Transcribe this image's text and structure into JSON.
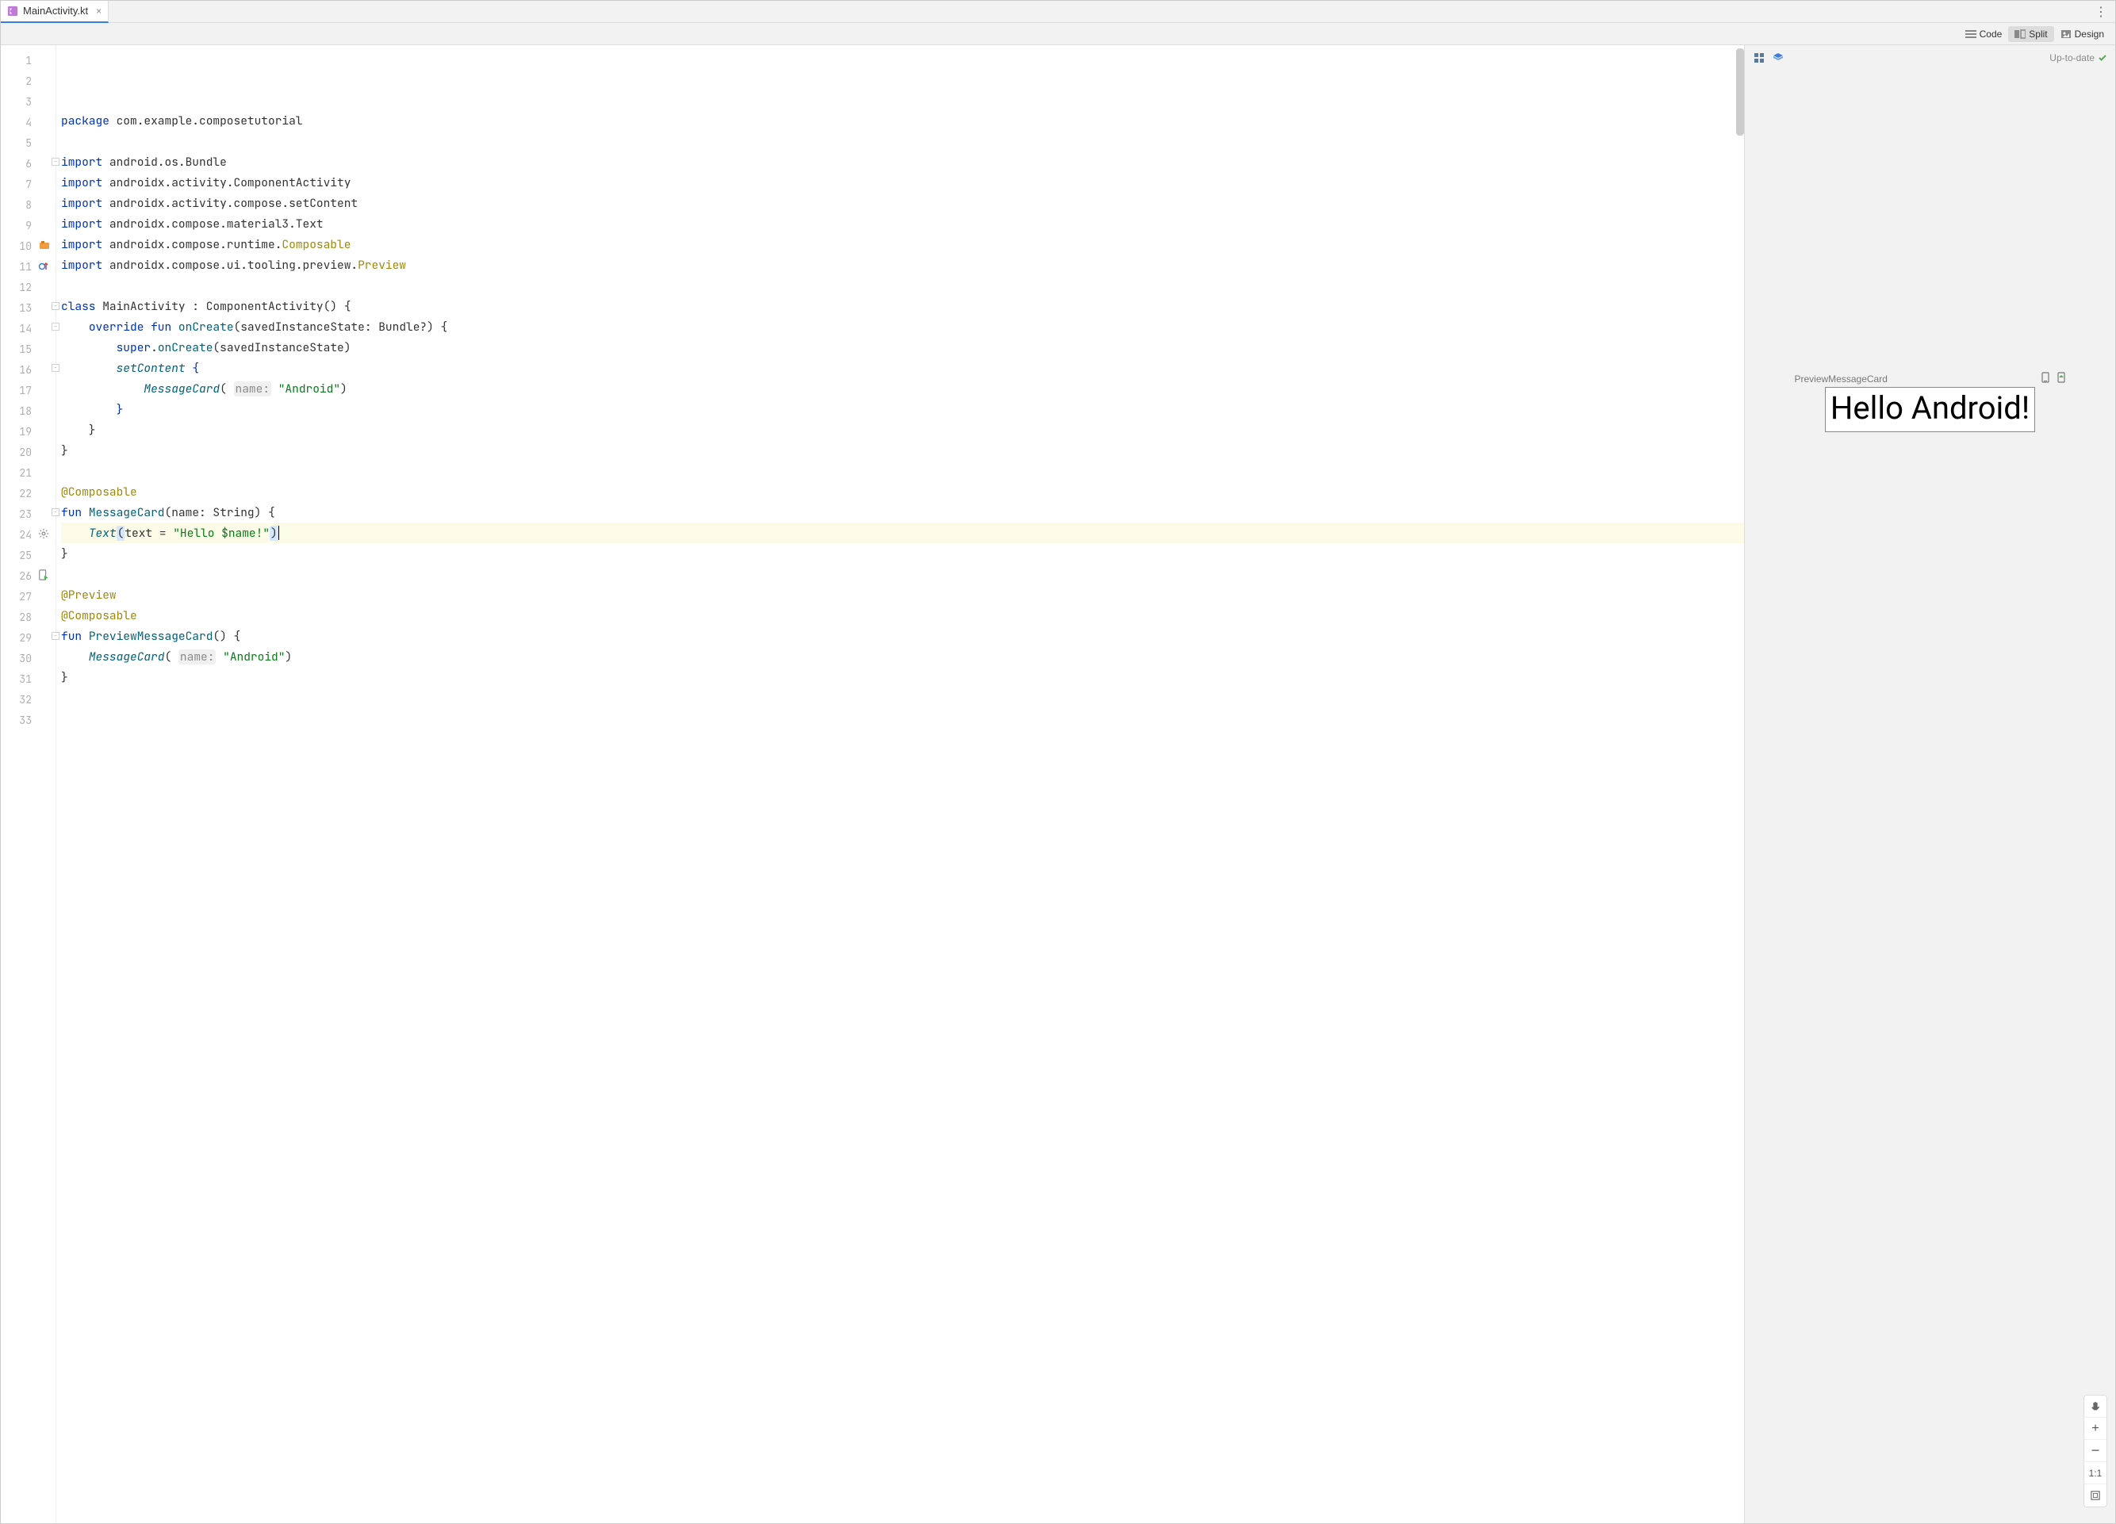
{
  "tab": {
    "filename": "MainActivity.kt"
  },
  "viewmodes": {
    "code": "Code",
    "split": "Split",
    "design": "Design",
    "active": "split"
  },
  "preview": {
    "status": "Up-to-date",
    "component_name": "PreviewMessageCard",
    "rendered_text": "Hello Android!"
  },
  "zoom": {
    "ratio": "1:1"
  },
  "code_lines": [
    {
      "n": 1,
      "tokens": [
        [
          "kw",
          "package"
        ],
        [
          "",
          " com.example.composetutorial"
        ]
      ]
    },
    {
      "n": 2,
      "tokens": []
    },
    {
      "n": 3,
      "fold": true,
      "tokens": [
        [
          "kw",
          "import"
        ],
        [
          "",
          " android.os.Bundle"
        ]
      ]
    },
    {
      "n": 4,
      "tokens": [
        [
          "kw",
          "import"
        ],
        [
          "",
          " androidx.activity.ComponentActivity"
        ]
      ]
    },
    {
      "n": 5,
      "tokens": [
        [
          "kw",
          "import"
        ],
        [
          "",
          " androidx.activity.compose.setContent"
        ]
      ]
    },
    {
      "n": 6,
      "tokens": [
        [
          "kw",
          "import"
        ],
        [
          "",
          " androidx.compose.material3.Text"
        ]
      ]
    },
    {
      "n": 7,
      "tokens": [
        [
          "kw",
          "import"
        ],
        [
          "",
          " androidx.compose.runtime."
        ],
        [
          "annref",
          "Composable"
        ]
      ]
    },
    {
      "n": 8,
      "tokens": [
        [
          "kw",
          "import"
        ],
        [
          "",
          " androidx.compose.ui.tooling.preview."
        ],
        [
          "annref",
          "Preview"
        ]
      ]
    },
    {
      "n": 9,
      "tokens": []
    },
    {
      "n": 10,
      "gicon": "class",
      "fold": true,
      "tokens": [
        [
          "kw",
          "class"
        ],
        [
          "",
          " MainActivity : ComponentActivity() {"
        ]
      ]
    },
    {
      "n": 11,
      "gicon": "override",
      "fold": true,
      "tokens": [
        [
          "",
          "    "
        ],
        [
          "kw",
          "override fun"
        ],
        [
          "",
          " "
        ],
        [
          "fn",
          "onCreate"
        ],
        [
          "",
          "(savedInstanceState: Bundle?) {"
        ]
      ]
    },
    {
      "n": 12,
      "tokens": [
        [
          "",
          "        "
        ],
        [
          "kw",
          "super"
        ],
        [
          "",
          "."
        ],
        [
          "fn",
          "onCreate"
        ],
        [
          "",
          "(savedInstanceState)"
        ]
      ]
    },
    {
      "n": 13,
      "fold": true,
      "tokens": [
        [
          "",
          "        "
        ],
        [
          "fn-i",
          "setContent"
        ],
        [
          "",
          " "
        ],
        [
          "kw",
          "{"
        ]
      ]
    },
    {
      "n": 14,
      "tokens": [
        [
          "",
          "            "
        ],
        [
          "fn-i",
          "MessageCard"
        ],
        [
          "",
          "( "
        ],
        [
          "param",
          "name:"
        ],
        [
          "",
          " "
        ],
        [
          "str",
          "\"Android\""
        ],
        [
          "",
          ")"
        ]
      ]
    },
    {
      "n": 15,
      "tokens": [
        [
          "",
          "        "
        ],
        [
          "kw",
          "}"
        ]
      ]
    },
    {
      "n": 16,
      "tokens": [
        [
          "",
          "    }"
        ]
      ]
    },
    {
      "n": 17,
      "tokens": [
        [
          "",
          "}"
        ]
      ]
    },
    {
      "n": 18,
      "tokens": []
    },
    {
      "n": 19,
      "tokens": [
        [
          "ann",
          "@Composable"
        ]
      ]
    },
    {
      "n": 20,
      "fold": true,
      "tokens": [
        [
          "kw",
          "fun"
        ],
        [
          "",
          " "
        ],
        [
          "fn",
          "MessageCard"
        ],
        [
          "",
          "(name: String) {"
        ]
      ]
    },
    {
      "n": 21,
      "caret": true,
      "tokens": [
        [
          "",
          "    "
        ],
        [
          "fn-i",
          "Text"
        ],
        [
          "brhl",
          "("
        ],
        [
          "",
          "text = "
        ],
        [
          "str",
          "\"Hello $name!\""
        ],
        [
          "brhl",
          ")"
        ]
      ],
      "caret_after": true
    },
    {
      "n": 22,
      "tokens": [
        [
          "",
          "}"
        ]
      ]
    },
    {
      "n": 23,
      "tokens": []
    },
    {
      "n": 24,
      "gicon": "gear",
      "tokens": [
        [
          "ann",
          "@Preview"
        ]
      ]
    },
    {
      "n": 25,
      "tokens": [
        [
          "ann",
          "@Composable"
        ]
      ]
    },
    {
      "n": 26,
      "gicon": "run",
      "fold": true,
      "tokens": [
        [
          "kw",
          "fun"
        ],
        [
          "",
          " "
        ],
        [
          "fn",
          "PreviewMessageCard"
        ],
        [
          "",
          "() {"
        ]
      ]
    },
    {
      "n": 27,
      "tokens": [
        [
          "",
          "    "
        ],
        [
          "fn-i",
          "MessageCard"
        ],
        [
          "",
          "( "
        ],
        [
          "param",
          "name:"
        ],
        [
          "",
          " "
        ],
        [
          "str",
          "\"Android\""
        ],
        [
          "",
          ")"
        ]
      ]
    },
    {
      "n": 28,
      "tokens": [
        [
          "",
          "}"
        ]
      ]
    },
    {
      "n": 29,
      "tokens": []
    },
    {
      "n": 30,
      "tokens": []
    },
    {
      "n": 31,
      "tokens": []
    },
    {
      "n": 32,
      "tokens": []
    },
    {
      "n": 33,
      "tokens": []
    }
  ]
}
